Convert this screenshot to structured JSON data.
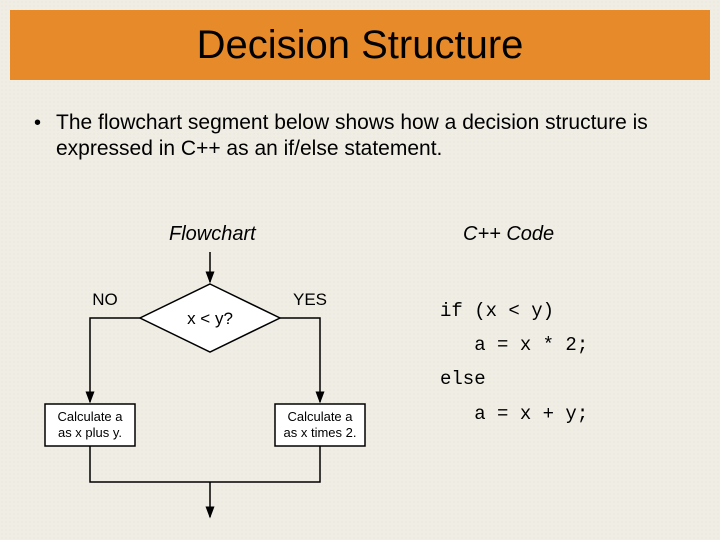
{
  "title": "Decision Structure",
  "bullet": "The flowchart segment below shows how a decision structure is expressed in C++ as an if/else statement.",
  "labels": {
    "flowchart": "Flowchart",
    "code": "C++ Code"
  },
  "flowchart": {
    "no": "NO",
    "yes": "YES",
    "condition": "x < y?",
    "box_left_line1": "Calculate a",
    "box_left_line2": "as x plus y.",
    "box_right_line1": "Calculate a",
    "box_right_line2": "as x times 2."
  },
  "code": {
    "line1": "if (x < y)",
    "line2": "   a = x * 2;",
    "line3": "else",
    "line4": "   a = x + y;"
  },
  "colors": {
    "title_bg": "#e78a2a",
    "slide_bg": "#f0ede4"
  },
  "chart_data": {
    "type": "flowchart",
    "title": "Decision Structure",
    "nodes": [
      {
        "id": "decision",
        "shape": "diamond",
        "label": "x < y?"
      },
      {
        "id": "yes_action",
        "shape": "rect",
        "label": "Calculate a as x times 2."
      },
      {
        "id": "no_action",
        "shape": "rect",
        "label": "Calculate a as x plus y."
      },
      {
        "id": "merge",
        "shape": "point"
      }
    ],
    "edges": [
      {
        "from": "entry",
        "to": "decision"
      },
      {
        "from": "decision",
        "to": "yes_action",
        "label": "YES"
      },
      {
        "from": "decision",
        "to": "no_action",
        "label": "NO"
      },
      {
        "from": "yes_action",
        "to": "merge"
      },
      {
        "from": "no_action",
        "to": "merge"
      },
      {
        "from": "merge",
        "to": "exit"
      }
    ],
    "equivalent_code": "if (x < y)\n   a = x * 2;\nelse\n   a = x + y;"
  }
}
